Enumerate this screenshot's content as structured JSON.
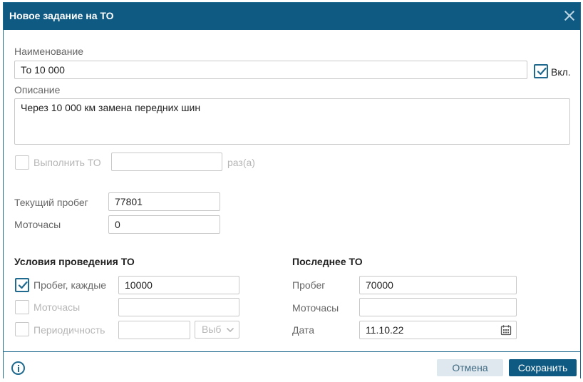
{
  "dialog": {
    "title": "Новое задание на ТО"
  },
  "form": {
    "name_label": "Наименование",
    "name_value": "То 10 000",
    "enabled_label": "Вкл.",
    "description_label": "Описание",
    "description_value": "Через 10 000 км замена передних шин",
    "perform_label": "Выполнить ТО",
    "perform_value": "",
    "times_label": "раз(а)",
    "current_mileage_label": "Текущий пробег",
    "current_mileage_value": "77801",
    "engine_hours_label": "Моточасы",
    "engine_hours_value": "0"
  },
  "conditions": {
    "title": "Условия проведения ТО",
    "mileage_label": "Пробег, каждые",
    "mileage_value": "10000",
    "engine_hours_label": "Моточасы",
    "engine_hours_value": "",
    "periodicity_label": "Периодичность",
    "periodicity_value": "",
    "periodicity_select": "Выб"
  },
  "last": {
    "title": "Последнее ТО",
    "mileage_label": "Пробег",
    "mileage_value": "70000",
    "engine_hours_label": "Моточасы",
    "engine_hours_value": "",
    "date_label": "Дата",
    "date_value": "11.10.22"
  },
  "footer": {
    "cancel": "Отмена",
    "save": "Сохранить"
  },
  "icons": {
    "close": "close-icon",
    "checkmark": "check-icon",
    "chevron": "chevron-down-icon",
    "calendar": "calendar-icon",
    "info": "info-icon"
  },
  "colors": {
    "accent": "#0f5a83",
    "checkbox": "#1f6a8e",
    "disabled_text": "#b6b6b6",
    "label_text": "#666666"
  }
}
